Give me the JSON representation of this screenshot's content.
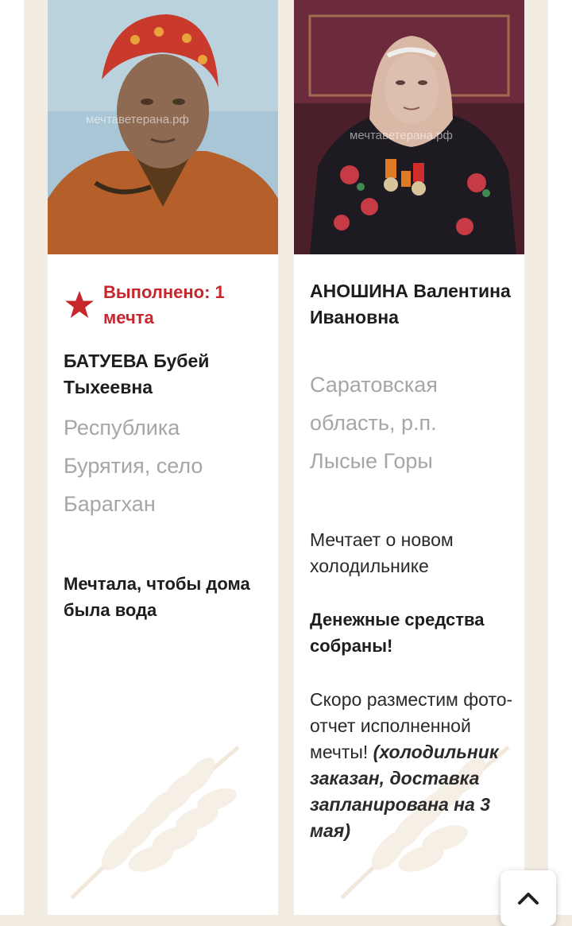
{
  "cards": [
    {
      "status": "Выполнено: 1 мечта",
      "name": "БАТУЕВА Бубей Тыхеевна",
      "location": "Республика Бурятия, село Барагхан",
      "dream": "Мечтала, чтобы дома была вода",
      "watermark": "мечтаветерана.рф"
    },
    {
      "name": "АНОШИНА Валентина Ивановна",
      "location": "Саратовская область, р.п. Лысые Горы",
      "dream": "Мечтает о новом холодильнике",
      "funds": "Денежные средства собраны!",
      "note": "Скоро разместим фото-отчет исполненной мечты!",
      "note_detail": "(холодильник заказан, доставка запланирована на 3 мая)",
      "watermark": "мечтаветерана.рф"
    }
  ],
  "colors": {
    "accent": "#c8262d",
    "background": "#f3ece3"
  },
  "icons": [
    "star-icon",
    "wheat-icon",
    "chevron-up-icon"
  ]
}
